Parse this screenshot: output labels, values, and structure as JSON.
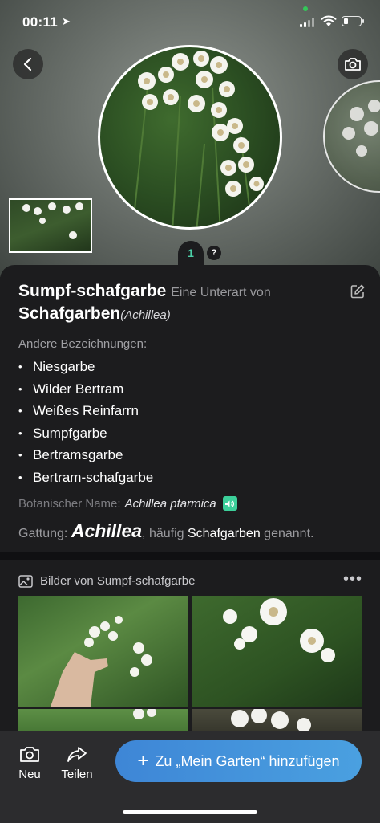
{
  "status": {
    "time": "00:11",
    "battery_level": 0.25
  },
  "hero": {
    "page_number": "1",
    "help_label": "?"
  },
  "card": {
    "common_name": "Sumpf-schafgarbe",
    "subspecies_text": "Eine Unterart von",
    "parent_name": "Schafgarben",
    "parent_latin": "(Achillea)",
    "aliases_title": "Andere Bezeichnungen:",
    "aliases": [
      "Niesgarbe",
      "Wilder Bertram",
      "Weißes Reinfarrn",
      "Sumpfgarbe",
      "Bertramsgarbe",
      "Bertram-schafgarbe"
    ],
    "botanical_label": "Botanischer Name:",
    "botanical_name": "Achillea ptarmica",
    "genus_label": "Gattung:",
    "genus_name": "Achillea",
    "genus_mid": ", häufig",
    "genus_common": "Schafgarben",
    "genus_end": "genannt."
  },
  "images": {
    "title": "Bilder von Sumpf-schafgarbe",
    "more": "•••"
  },
  "bottom": {
    "new_label": "Neu",
    "share_label": "Teilen",
    "add_label": "Zu „Mein Garten“ hinzufügen",
    "add_plus": "+"
  },
  "colors": {
    "accent": "#4aa0e0",
    "teal": "#3ccf9a",
    "background": "#1c1c1e"
  }
}
